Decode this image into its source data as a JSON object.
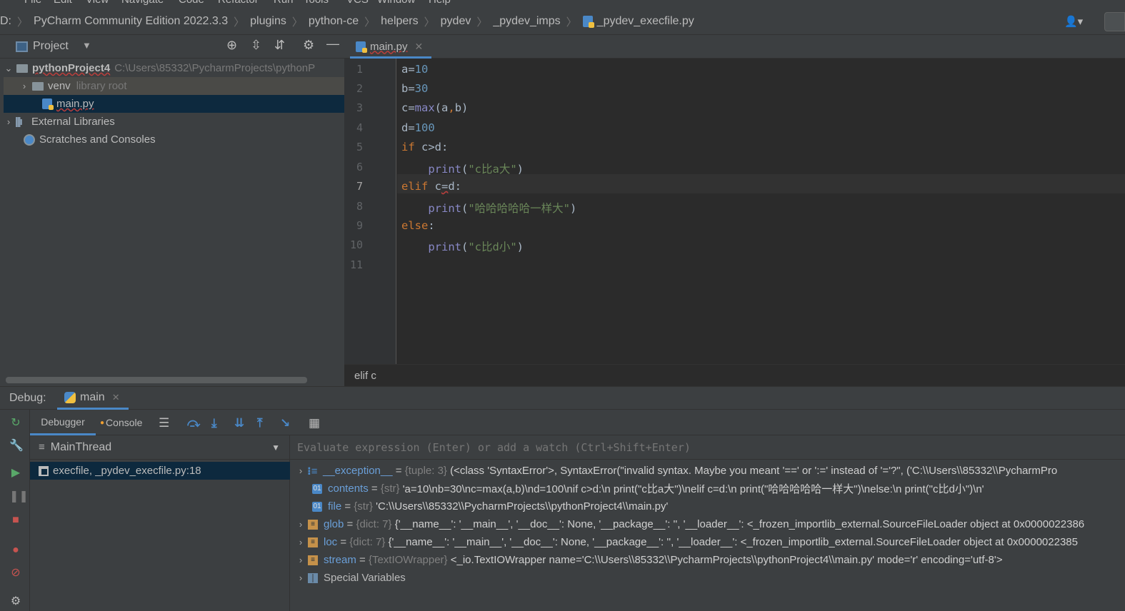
{
  "menubar": {
    "items": [
      "File",
      "Edit",
      "View",
      "Navigate",
      "Code",
      "Refactor",
      "Run",
      "Tools",
      "VCS",
      "Window",
      "Help"
    ]
  },
  "navbar": {
    "prefix": "D:",
    "crumbs": [
      "PyCharm Community Edition 2022.3.3",
      "plugins",
      "python-ce",
      "helpers",
      "pydev",
      "_pydev_imps",
      "_pydev_execfile.py"
    ]
  },
  "project": {
    "title": "Project",
    "tree": [
      {
        "label": "pythonProject4",
        "extra": "C:\\Users\\85332\\PycharmProjects\\pythonP"
      },
      {
        "label": "venv",
        "extra": "library root"
      },
      {
        "label": "main.py"
      },
      {
        "label": "External Libraries"
      },
      {
        "label": "Scratches and Consoles"
      }
    ]
  },
  "editor": {
    "tab": "main.py",
    "line_numbers": [
      "1",
      "2",
      "3",
      "4",
      "5",
      "6",
      "7",
      "8",
      "9",
      "10",
      "11"
    ],
    "breadcrumb": "elif c"
  },
  "debug": {
    "label": "Debug:",
    "session_tab": "main",
    "tabs": {
      "debugger": "Debugger",
      "console": "Console"
    },
    "thread": "MainThread",
    "frame": "execfile, _pydev_execfile.py:18",
    "evaluate_placeholder": "Evaluate expression (Enter) or add a watch (Ctrl+Shift+Enter)",
    "variables": [
      {
        "name": "__exception__",
        "type": "{tuple: 3}",
        "value": "(<class 'SyntaxError'>, SyntaxError(\"invalid syntax. Maybe you meant '==' or ':=' instead of '='?\", ('C:\\\\Users\\\\85332\\\\PycharmPro"
      },
      {
        "name": "contents",
        "type": "{str}",
        "value": "'a=10\\nb=30\\nc=max(a,b)\\nd=100\\nif c>d:\\n    print(\"c比a大\")\\nelif c=d:\\n    print(\"哈哈哈哈哈一样大\")\\nelse:\\n    print(\"c比d小\")\\n'"
      },
      {
        "name": "file",
        "type": "{str}",
        "value": "'C:\\\\Users\\\\85332\\\\PycharmProjects\\\\pythonProject4\\\\main.py'"
      },
      {
        "name": "glob",
        "type": "{dict: 7}",
        "value": "{'__name__': '__main__', '__doc__': None, '__package__': '', '__loader__': <_frozen_importlib_external.SourceFileLoader object at 0x0000022386"
      },
      {
        "name": "loc",
        "type": "{dict: 7}",
        "value": "{'__name__': '__main__', '__doc__': None, '__package__': '', '__loader__': <_frozen_importlib_external.SourceFileLoader object at 0x0000022385"
      },
      {
        "name": "stream",
        "type": "{TextIOWrapper}",
        "value": "<_io.TextIOWrapper name='C:\\\\Users\\\\85332\\\\PycharmProjects\\\\pythonProject4\\\\main.py' mode='r' encoding='utf-8'>"
      },
      {
        "name": "Special Variables",
        "type": "",
        "value": ""
      }
    ]
  },
  "colors": {
    "accent": "#4a88c7",
    "selection": "#0d293e",
    "keyword": "#cc7832",
    "number": "#6897bb",
    "string": "#6a8759",
    "builtin": "#8888c6"
  }
}
